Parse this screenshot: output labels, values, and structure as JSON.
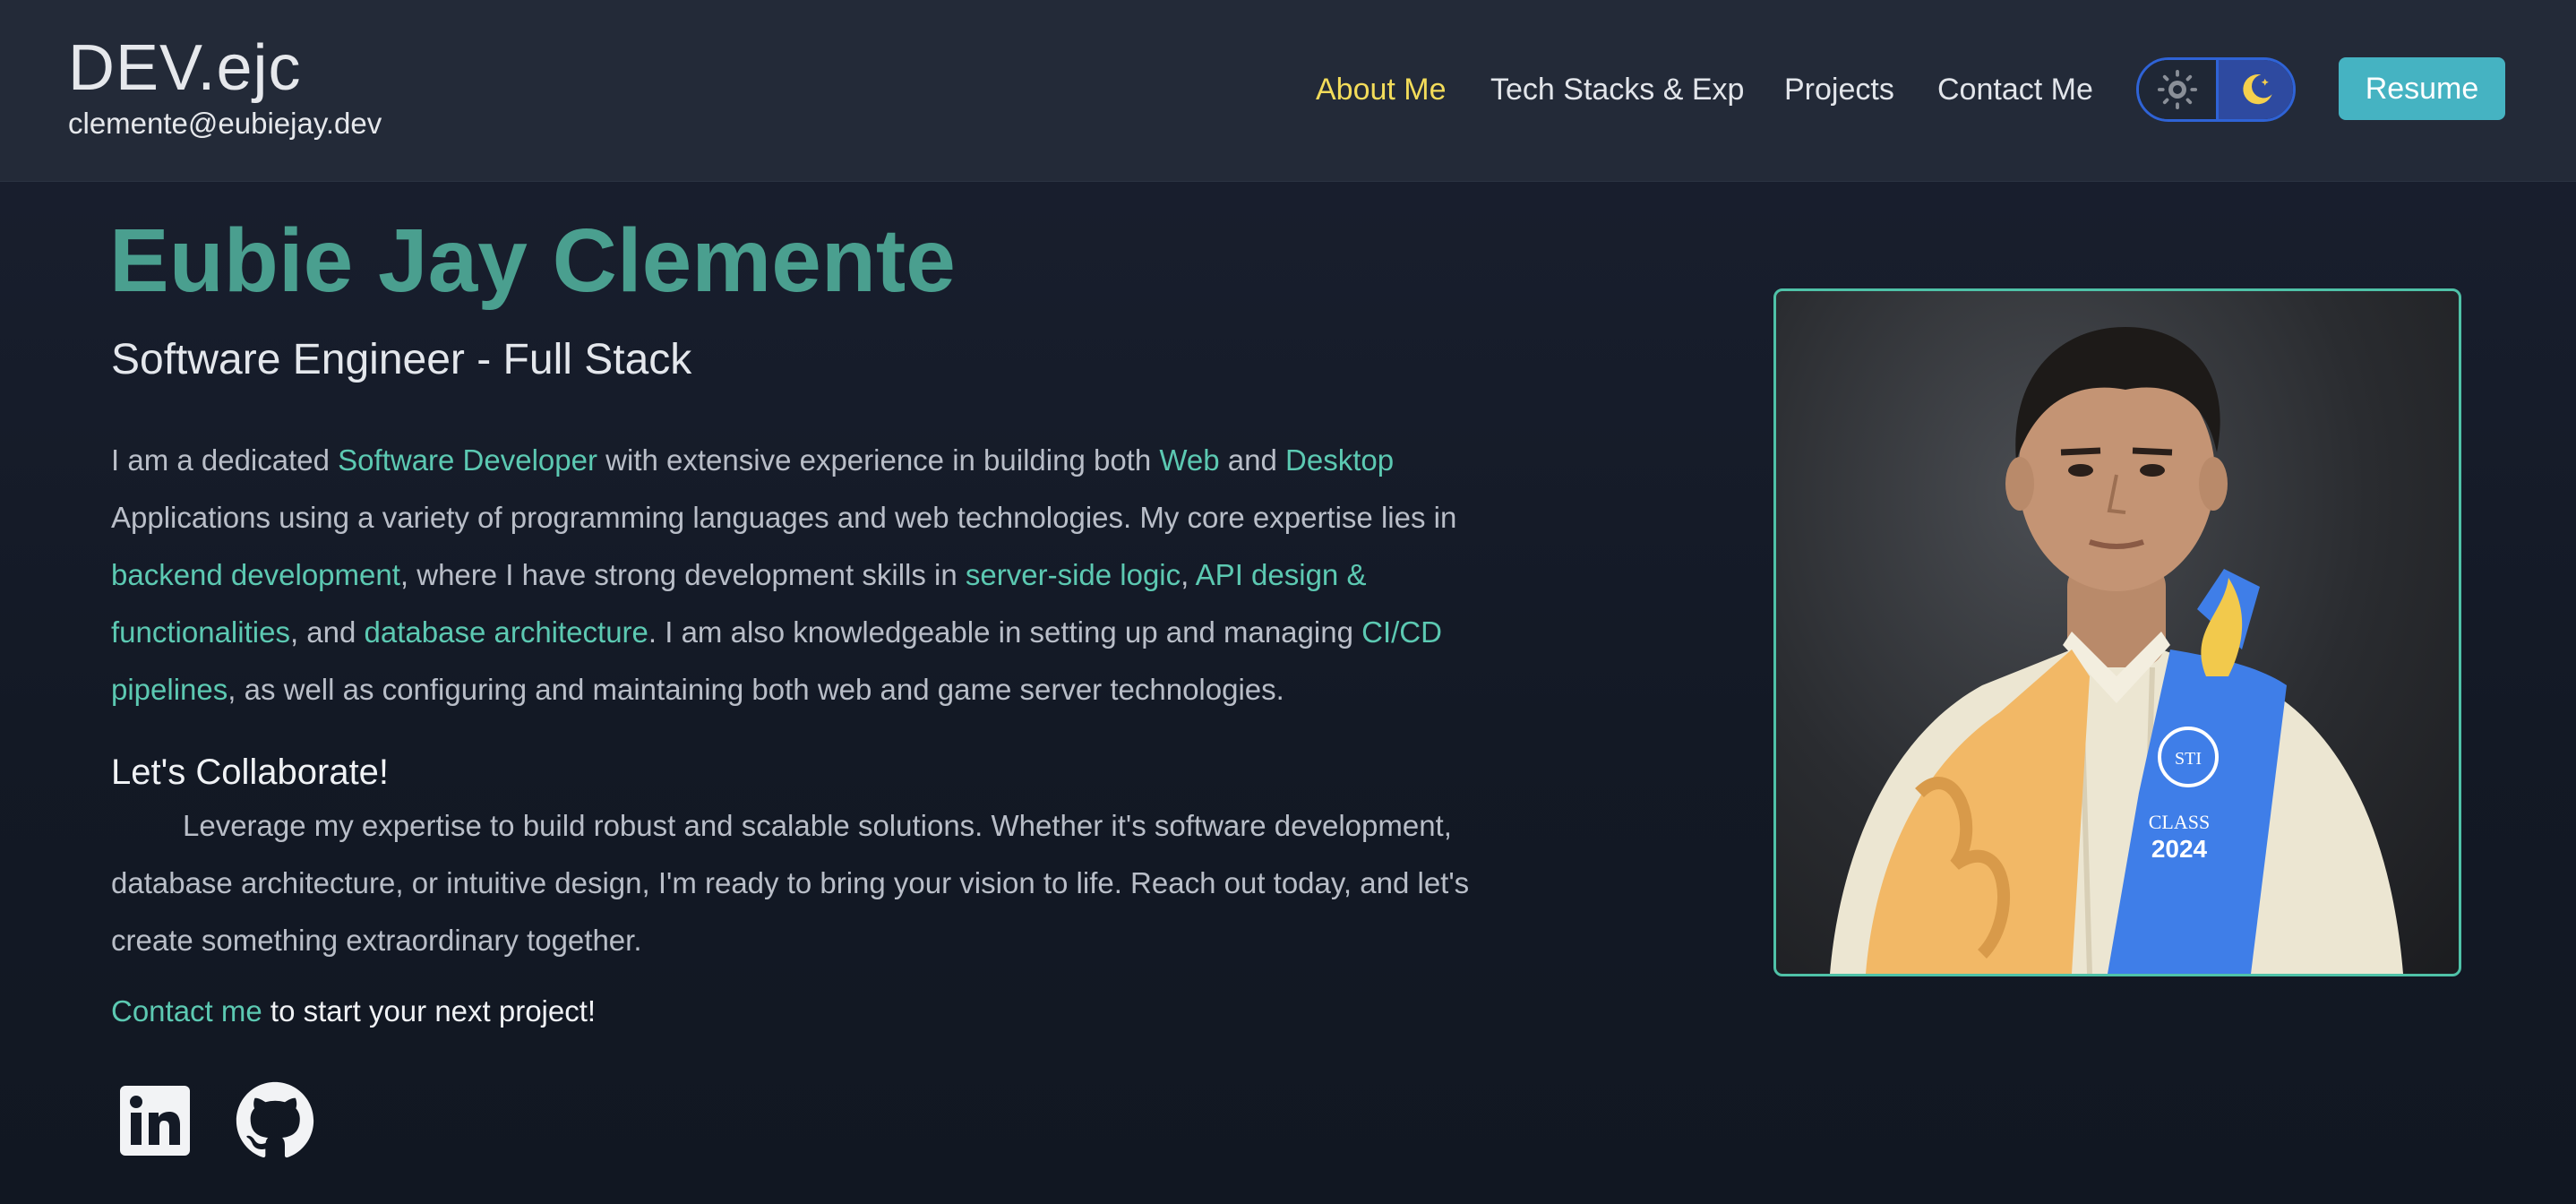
{
  "header": {
    "brand_title": "DEV.ejc",
    "brand_email": "clemente@eubiejay.dev",
    "nav": [
      "About Me",
      "Tech Stacks & Exp",
      "Projects",
      "Contact Me"
    ],
    "active_nav": "About Me",
    "resume_label": "Resume",
    "theme_toggle": {
      "options": [
        "sun-icon",
        "moon-icon"
      ],
      "selected": "dark"
    }
  },
  "hero": {
    "name": "Eubie Jay Clemente",
    "role": "Software Engineer - Full Stack",
    "bio": [
      {
        "text": "I am a dedicated "
      },
      {
        "text": "Software Developer",
        "hl": true
      },
      {
        "text": " with extensive experience in building both "
      },
      {
        "text": "Web",
        "hl": true
      },
      {
        "text": " and "
      },
      {
        "text": "Desktop",
        "hl": true
      },
      {
        "text": " Applications using a variety of programming languages and web technologies. My core expertise lies in "
      },
      {
        "text": "backend development",
        "hl": true
      },
      {
        "text": ", where I have strong development skills in "
      },
      {
        "text": "server-side logic",
        "hl": true
      },
      {
        "text": ", "
      },
      {
        "text": "API design & functionalities",
        "hl": true
      },
      {
        "text": ", and "
      },
      {
        "text": "database architecture",
        "hl": true
      },
      {
        "text": ". I am also knowledgeable in setting up and managing "
      },
      {
        "text": "CI/CD pipelines",
        "hl": true
      },
      {
        "text": ", as well as configuring and maintaining both web and game server technologies."
      }
    ],
    "collab_title": "Let's Collaborate!",
    "collab_text": "Leverage my expertise to build robust and scalable solutions. Whether it's software development, database architecture, or intuitive design, I'm ready to bring your vision to life. Reach out today, and let's create something extraordinary together.",
    "cta_link": "Contact me",
    "cta_text": " to start your next project!"
  },
  "social": [
    "linkedin-icon",
    "github-icon"
  ],
  "photo": {
    "stole_text_1": "STI",
    "stole_text_2": "CLASS",
    "stole_text_3": "2024"
  },
  "colors": {
    "accent": "#5cc9b2",
    "name": "#4a9f8f",
    "active_nav": "#f3dc5a",
    "resume_button": "#45b3c2",
    "header_bg": "#232a38",
    "page_bg": "#141a26"
  }
}
